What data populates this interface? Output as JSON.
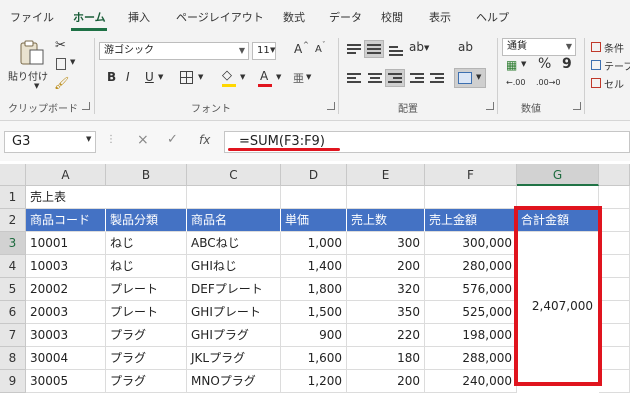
{
  "menu": {
    "tabs": [
      "ファイル",
      "ホーム",
      "挿入",
      "ページレイアウト",
      "数式",
      "データ",
      "校閲",
      "表示",
      "ヘルプ"
    ],
    "active_tab": "ホーム"
  },
  "ribbon": {
    "clipboard": {
      "paste_label": "貼り付け",
      "group_label": "クリップボード"
    },
    "font": {
      "font_name": "游ゴシック",
      "font_size": "11",
      "bold": "B",
      "italic": "I",
      "underline": "U",
      "grow": "A",
      "shrink": "A",
      "phonetic": "亜",
      "font_color_glyph": "A",
      "group_label": "フォント"
    },
    "alignment": {
      "group_label": "配置"
    },
    "number": {
      "format": "通貨",
      "percent": "%",
      "comma": "9",
      "dec_increase": "←.00",
      "dec_decrease": ".00→0",
      "group_label": "数値"
    },
    "styles": {
      "conditional": "条件",
      "table": "テーブ",
      "cell": "セル"
    }
  },
  "formula_bar": {
    "name_box": "G3",
    "cancel": "×",
    "enter": "✓",
    "fx": "fx",
    "formula": "=SUM(F3:F9)"
  },
  "sheet": {
    "columns": [
      "A",
      "B",
      "C",
      "D",
      "E",
      "F",
      "G"
    ],
    "selected_column": "G",
    "rows": [
      "1",
      "2",
      "3",
      "4",
      "5",
      "6",
      "7",
      "8",
      "9"
    ],
    "selected_row": "3",
    "title": "売上表",
    "headers": [
      "商品コード",
      "製品分類",
      "商品名",
      "単価",
      "売上数",
      "売上金額",
      "合計金額"
    ],
    "data": [
      [
        "10001",
        "ねじ",
        "ABCねじ",
        "1,000",
        "300",
        "300,000"
      ],
      [
        "10003",
        "ねじ",
        "GHIねじ",
        "1,400",
        "200",
        "280,000"
      ],
      [
        "20002",
        "プレート",
        "DEFプレート",
        "1,800",
        "320",
        "576,000"
      ],
      [
        "20003",
        "プレート",
        "GHIプレート",
        "1,500",
        "350",
        "525,000"
      ],
      [
        "30003",
        "プラグ",
        "GHIプラグ",
        "900",
        "220",
        "198,000"
      ],
      [
        "30004",
        "プラグ",
        "JKLプラグ",
        "1,600",
        "180",
        "288,000"
      ],
      [
        "30005",
        "プラグ",
        "MNOプラグ",
        "1,200",
        "200",
        "240,000"
      ]
    ],
    "total": "2,407,000"
  },
  "colors": {
    "accent_green": "#217346",
    "header_blue": "#4472c4",
    "highlight_red": "#e0141e"
  }
}
